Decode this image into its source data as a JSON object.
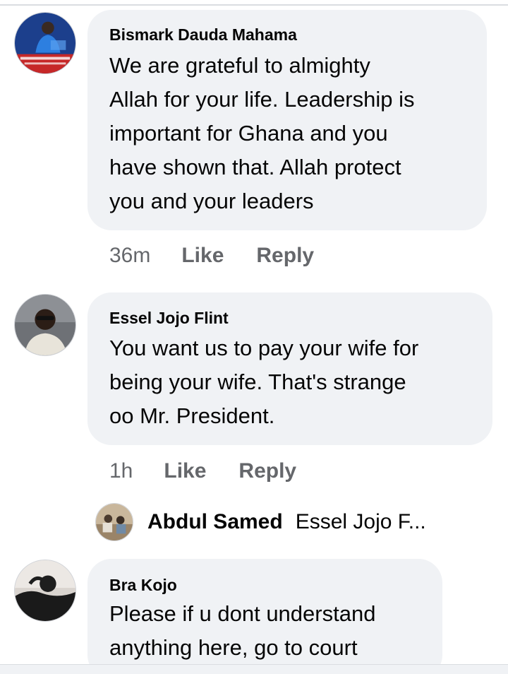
{
  "comments": [
    {
      "author": "Bismark Dauda Mahama",
      "text": "We are grateful to almighty\nAllah for your life. Leadership is\nimportant for Ghana and you\nhave shown that. Allah protect\nyou and your leaders",
      "time": "36m",
      "like_label": "Like",
      "reply_label": "Reply",
      "avatar_icon": "profile-photo-icon"
    },
    {
      "author": "Essel Jojo Flint",
      "text": "You want us to pay your wife for\nbeing your wife. That's strange\noo Mr. President.",
      "time": "1h",
      "like_label": "Like",
      "reply_label": "Reply",
      "avatar_icon": "profile-photo-icon",
      "reply_preview": {
        "author": "Abdul Samed",
        "text": "Essel Jojo F..."
      }
    },
    {
      "author": "Bra Kojo",
      "text": "Please if u dont understand\nanything here, go to court",
      "avatar_icon": "profile-photo-icon"
    }
  ],
  "colors": {
    "bubble": "#f0f2f5",
    "secondary_text": "#65676b",
    "primary_text": "#050505"
  }
}
